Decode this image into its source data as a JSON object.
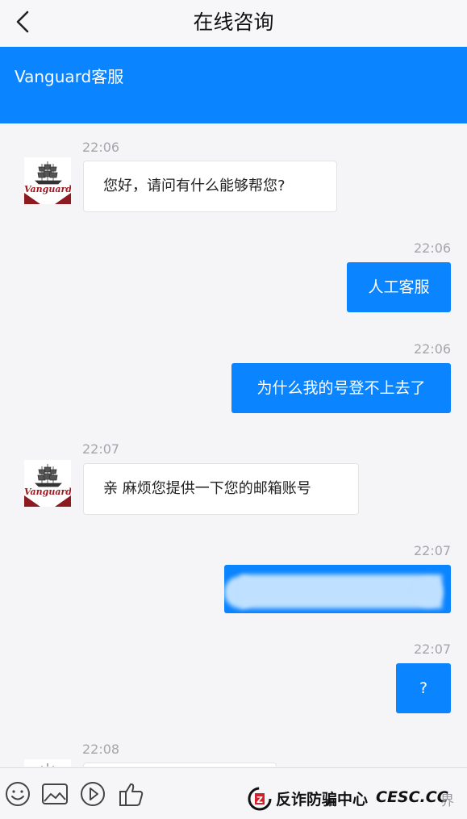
{
  "header": {
    "title": "在线咨询",
    "back_icon": "chevron-left-icon"
  },
  "banner": {
    "title": "Vanguard客服",
    "color": "#0a84ff"
  },
  "avatar": {
    "logo_text": "Vanguard"
  },
  "messages": [
    {
      "side": "in",
      "time": "22:06",
      "text": "您好，请问有什么能够帮您?"
    },
    {
      "side": "out",
      "time": "22:06",
      "text": "人工客服"
    },
    {
      "side": "out",
      "time": "22:06",
      "text": "为什么我的号登不上去了"
    },
    {
      "side": "in",
      "time": "22:07",
      "text": "亲 麻烦您提供一下您的邮箱账号"
    },
    {
      "side": "out",
      "time": "22:07",
      "text": ""
    },
    {
      "side": "out",
      "time": "22:07",
      "text": "?"
    },
    {
      "side": "in",
      "time": "22:08",
      "text": ""
    }
  ],
  "toolbar": {
    "icons": [
      "emoji-icon",
      "image-icon",
      "play-icon",
      "thumbs-up-icon"
    ]
  },
  "watermark": {
    "cn": "反诈防骗中心",
    "en": "CESC.CC",
    "tail": "界"
  }
}
